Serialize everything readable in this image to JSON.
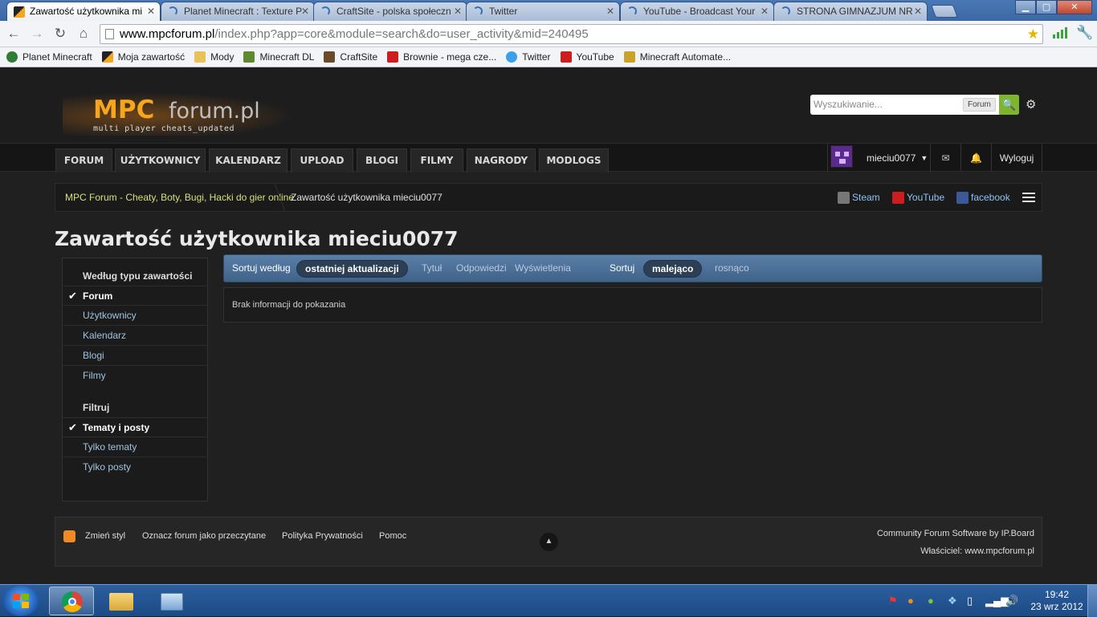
{
  "browser": {
    "tabs": [
      {
        "label": "Zawartość użytkownika mi",
        "active": true
      },
      {
        "label": "Planet Minecraft : Texture P",
        "active": false
      },
      {
        "label": "CraftSite - polska społeczn",
        "active": false
      },
      {
        "label": "Twitter",
        "active": false
      },
      {
        "label": "YouTube - Broadcast Your",
        "active": false
      },
      {
        "label": "STRONA GIMNAZJUM NR",
        "active": false
      }
    ],
    "url_host": "www.mpcforum.pl",
    "url_path": "/index.php?app=core&module=search&do=user_activity&mid=240495",
    "bookmarks": [
      {
        "label": "Planet Minecraft",
        "icon": "globe-icon",
        "color": "#2e7d32"
      },
      {
        "label": "Moja zawartość",
        "icon": "mpc-icon",
        "color": "#f7a51c"
      },
      {
        "label": "Mody",
        "icon": "folder-icon",
        "color": "#e8c15a"
      },
      {
        "label": "Minecraft DL",
        "icon": "minecraft-icon",
        "color": "#5d8a2e"
      },
      {
        "label": "CraftSite",
        "icon": "craftsite-icon",
        "color": "#6b4a2a"
      },
      {
        "label": "Brownie - mega cze...",
        "icon": "youtube-icon",
        "color": "#cc1e1e"
      },
      {
        "label": "Twitter",
        "icon": "twitter-icon",
        "color": "#3aa0e8"
      },
      {
        "label": "YouTube",
        "icon": "youtube-icon",
        "color": "#cc1e1e"
      },
      {
        "label": "Minecraft Automate...",
        "icon": "automate-icon",
        "color": "#c9a227"
      }
    ]
  },
  "site": {
    "logo_mpc": "MPC",
    "logo_forum": "forum.pl",
    "logo_tagline": "multi player cheats_updated",
    "search_placeholder": "Wyszukiwanie...",
    "search_scope": "Forum",
    "nav": [
      "FORUM",
      "UŻYTKOWNICY",
      "KALENDARZ",
      "UPLOAD",
      "BLOGI",
      "FILMY",
      "NAGRODY",
      "MODLOGS"
    ],
    "username": "mieciu0077",
    "logout": "Wyloguj",
    "breadcrumb_home": "MPC Forum - Cheaty, Boty, Bugi, Hacki do gier online",
    "breadcrumb_current": "Zawartość użytkownika mieciu0077",
    "social": [
      "Steam",
      "YouTube",
      "facebook"
    ],
    "page_title": "Zawartość użytkownika mieciu0077"
  },
  "sidebar": {
    "content_type_heading": "Według typu zawartości",
    "content_types": [
      {
        "label": "Forum",
        "active": true
      },
      {
        "label": "Użytkownicy",
        "active": false
      },
      {
        "label": "Kalendarz",
        "active": false
      },
      {
        "label": "Blogi",
        "active": false
      },
      {
        "label": "Filmy",
        "active": false
      }
    ],
    "filter_heading": "Filtruj",
    "filters": [
      {
        "label": "Tematy i posty",
        "active": true
      },
      {
        "label": "Tylko tematy",
        "active": false
      },
      {
        "label": "Tylko posty",
        "active": false
      }
    ]
  },
  "sort": {
    "sort_by_label": "Sortuj według",
    "sort_by_selected": "ostatniej aktualizacji",
    "sort_by_options": [
      "Tytuł",
      "Odpowiedzi",
      "Wyświetlenia"
    ],
    "order_label": "Sortuj",
    "order_selected": "malejąco",
    "order_other": "rosnąco"
  },
  "results": {
    "empty_message": "Brak informacji do pokazania"
  },
  "footer": {
    "links": [
      "Zmień styl",
      "Oznacz forum jako przeczytane",
      "Polityka Prywatności",
      "Pomoc"
    ],
    "powered_by": "Community Forum Software by IP.Board",
    "owner": "Właściciel: www.mpcforum.pl"
  },
  "taskbar": {
    "time": "19:42",
    "date": "23 wrz 2012"
  }
}
